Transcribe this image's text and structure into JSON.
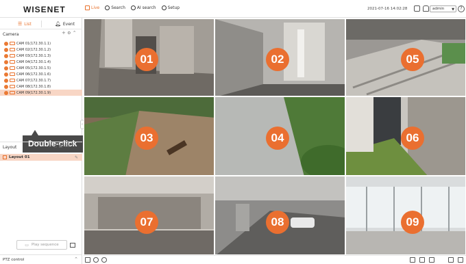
{
  "app": {
    "logo": "WISENET"
  },
  "menu": [
    {
      "label": "Live",
      "active": true,
      "icon": "live-icon"
    },
    {
      "label": "Search",
      "active": false,
      "icon": "search-icon"
    },
    {
      "label": "AI search",
      "active": false,
      "icon": "ai-search-icon"
    },
    {
      "label": "Setup",
      "active": false,
      "icon": "gear-icon"
    }
  ],
  "header": {
    "datetime": "2021-07-16 14:02:28",
    "user": "admin",
    "help": "?"
  },
  "sidebar": {
    "tabs": [
      {
        "label": "List",
        "active": true
      },
      {
        "label": "Event",
        "active": false
      }
    ],
    "camera_title": "Camera",
    "cameras": [
      "CAM 01(172.30.1.1)",
      "CAM 02(172.30.1.2)",
      "CAM 03(172.30.1.3)",
      "CAM 04(172.30.1.4)",
      "CAM 05(172.30.1.5)",
      "CAM 06(172.30.1.6)",
      "CAM 07(172.30.1.7)",
      "CAM 08(172.30.1.8)",
      "CAM 09(172.30.1.9)"
    ],
    "selected_camera_index": 8,
    "callout": "Double-click",
    "layout_title": "Layout",
    "layout_item": "Layout 01",
    "play_sequence": "Play sequence",
    "ptz_control": "PTZ control"
  },
  "tiles": [
    "01",
    "02",
    "05",
    "03",
    "04",
    "06",
    "07",
    "08",
    "09"
  ],
  "colors": {
    "accent": "#e8702a",
    "badge": "#ea6f30",
    "selected_row": "#f8d6c5",
    "callout": "#494949"
  }
}
